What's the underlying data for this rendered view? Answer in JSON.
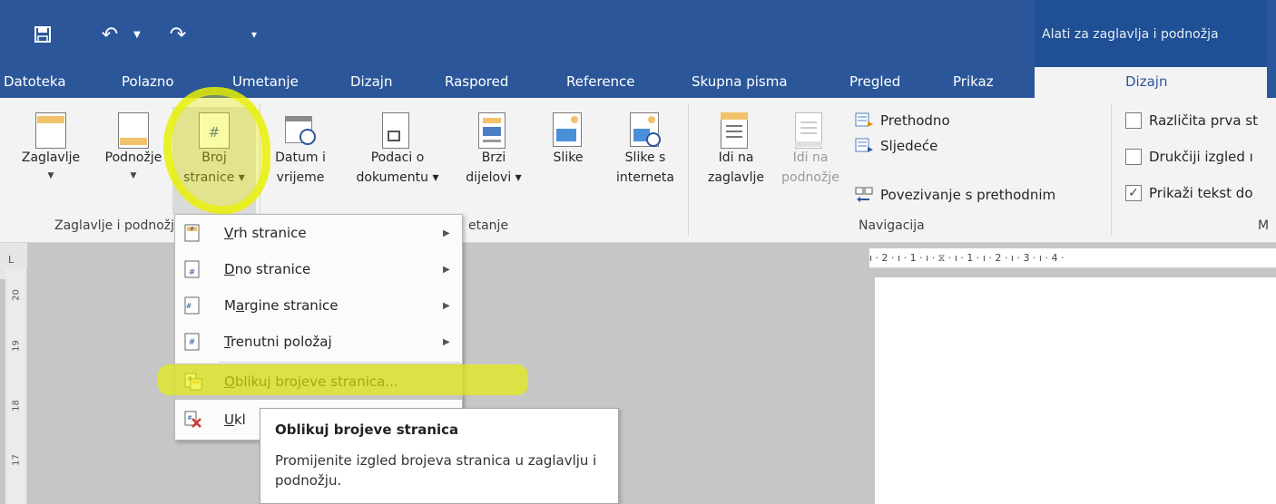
{
  "colors": {
    "accent": "#2b579a",
    "highlight": "#e8f000",
    "ribbon_bg": "#f3f3f3",
    "workspace": "#c6c6c6"
  },
  "qat": {
    "save_icon": "save-icon",
    "undo_icon": "undo-icon",
    "redo_icon": "redo-icon",
    "customize_icon": "customize-qat-icon"
  },
  "context_title": "Alati za zaglavlja i podnožja",
  "tabs": {
    "datoteka": "Datoteka",
    "polazno": "Polazno",
    "umetanje": "Umetanje",
    "dizajn": "Dizajn",
    "raspored": "Raspored",
    "reference": "Reference",
    "skupna_pisma": "Skupna pisma",
    "pregled": "Pregled",
    "prikaz": "Prikaz",
    "dizajn_active": "Dizajn"
  },
  "ribbon": {
    "zaglavlje": "Zaglavlje",
    "podnozje": "Podnožje",
    "broj_line1": "Broj",
    "broj_line2": "stranice ▾",
    "datum_line1": "Datum i",
    "datum_line2": "vrijeme",
    "podaci_line1": "Podaci o",
    "podaci_line2": "dokumentu ▾",
    "brzi_line1": "Brzi",
    "brzi_line2": "dijelovi ▾",
    "slike": "Slike",
    "slike_int_line1": "Slike s",
    "slike_int_line2": "interneta",
    "idi_zaglavlje_line1": "Idi na",
    "idi_zaglavlje_line2": "zaglavlje",
    "idi_podnozje_line1": "Idi na",
    "idi_podnozje_line2": "podnožje",
    "prethodno": "Prethodno",
    "sljedece": "Sljedeće",
    "povezivanje": "Povezivanje s prethodnim",
    "razlicita_prva": "Različita prva st",
    "drukciji_izgled": "Drukčiji izgled ı",
    "prikazi_tekst": "Prikaži tekst do",
    "prikazi_checked": "✓",
    "group_zaglavlje": "Zaglavlje i podnožje",
    "group_umetanje": "etanje",
    "group_navigacija": "Navigacija",
    "group_mogucnosti": "M"
  },
  "ruler": {
    "top_text": "ı · 2 · ı · 1 · ı · ⧖ · ı · 1 · ı · 2 · ı · 3 · ı · 4 ·",
    "left_corner": "L",
    "left_nums": [
      "20",
      "19",
      "18",
      "17"
    ]
  },
  "menu": {
    "items": [
      {
        "pre": "",
        "ul": "V",
        "post": "rh stranice",
        "submenu": "▶"
      },
      {
        "pre": "",
        "ul": "D",
        "post": "no stranice",
        "submenu": "▶"
      },
      {
        "pre": "M",
        "ul": "a",
        "post": "rgine stranice",
        "submenu": "▶"
      },
      {
        "pre": "",
        "ul": "T",
        "post": "renutni položaj",
        "submenu": "▶"
      },
      {
        "pre": "",
        "ul": "O",
        "post": "blikuj brojeve stranica...",
        "submenu": ""
      },
      {
        "pre": "",
        "ul": "U",
        "post": "kl",
        "submenu": ""
      }
    ]
  },
  "tooltip": {
    "title": "Oblikuj brojeve stranica",
    "description": "Promijenite izgled brojeva stranica u zaglavlju i podnožju."
  }
}
